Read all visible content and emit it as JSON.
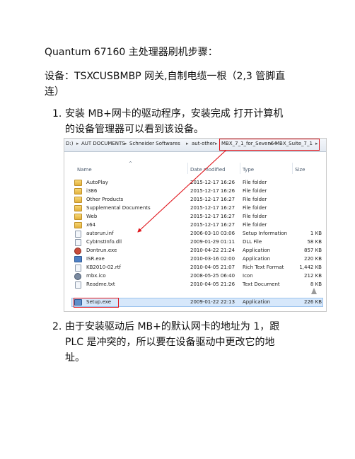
{
  "doc": {
    "title": "Quantum 67160 主处理器刷机步骤：",
    "equipment_line1": "设备：TSXCUSBMBP 网关,自制电缆一根（2,3 管脚直",
    "equipment_line2": "连）",
    "step1_num": "1.",
    "step1_line1": "安装 MB+网卡的驱动程序，安装完成 打开计算机",
    "step1_line2": "的设备管理器可以看到该设备。",
    "step2_num": "2.",
    "step2_line1": "由于安装驱动后 MB+的默认网卡的地址为 1，跟",
    "step2_line2": "PLC 是冲突的，所以要在设备驱动中更改它的地",
    "step2_line3": "址。"
  },
  "explorer": {
    "address": [
      "D:)",
      "AUT DOCUMENTS",
      "Schneider Softwares",
      "aut-other",
      "MBX_7_1_for_Seven64",
      "MBX_Suite_7_1"
    ],
    "columns": {
      "name": "Name",
      "date": "Date modified",
      "type": "Type",
      "size": "Size"
    },
    "files": [
      {
        "name": "AutoPlay",
        "date": "2015-12-17 16:26",
        "type": "File folder",
        "size": "",
        "icon": "folder-icon"
      },
      {
        "name": "i386",
        "date": "2015-12-17 16:26",
        "type": "File folder",
        "size": "",
        "icon": "folder-icon"
      },
      {
        "name": "Other Products",
        "date": "2015-12-17 16:27",
        "type": "File folder",
        "size": "",
        "icon": "folder-icon"
      },
      {
        "name": "Supplemental Documents",
        "date": "2015-12-17 16:27",
        "type": "File folder",
        "size": "",
        "icon": "folder-icon"
      },
      {
        "name": "Web",
        "date": "2015-12-17 16:27",
        "type": "File folder",
        "size": "",
        "icon": "folder-icon"
      },
      {
        "name": "x64",
        "date": "2015-12-17 16:27",
        "type": "File folder",
        "size": "",
        "icon": "folder-icon"
      },
      {
        "name": "autorun.inf",
        "date": "2006-03-10 03:06",
        "type": "Setup Information",
        "size": "1 KB",
        "icon": "setup-info-icon"
      },
      {
        "name": "CybInstInfo.dll",
        "date": "2009-01-29 01:11",
        "type": "DLL File",
        "size": "58 KB",
        "icon": "dll-icon"
      },
      {
        "name": "Dontrun.exe",
        "date": "2010-04-22 21:24",
        "type": "Application",
        "size": "857 KB",
        "icon": "app-icon"
      },
      {
        "name": "ISR.exe",
        "date": "2010-03-16 02:00",
        "type": "Application",
        "size": "220 KB",
        "icon": "app-icon"
      },
      {
        "name": "KB2010-02.rtf",
        "date": "2010-04-05 21:07",
        "type": "Rich Text Format",
        "size": "1,442 KB",
        "icon": "rtf-icon"
      },
      {
        "name": "mbx.ico",
        "date": "2008-05-25 06:40",
        "type": "Icon",
        "size": "212 KB",
        "icon": "ico-icon"
      },
      {
        "name": "Readme.txt",
        "date": "2010-04-05 21:26",
        "type": "Text Document",
        "size": "8 KB",
        "icon": "text-icon"
      },
      {
        "name": "Setup.exe",
        "date": "2009-01-22 22:13",
        "type": "Application",
        "size": "226 KB",
        "icon": "setup-exe-icon"
      }
    ]
  },
  "colors": {
    "highlight": "#e0141b"
  }
}
